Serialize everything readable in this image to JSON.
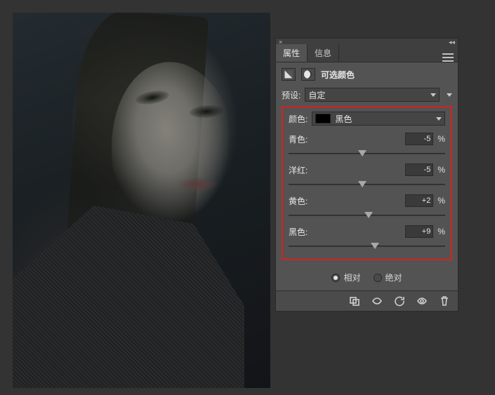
{
  "tabs": {
    "properties": "属性",
    "info": "信息"
  },
  "panel": {
    "title": "可选颜色"
  },
  "preset": {
    "label": "预设:",
    "value": "自定"
  },
  "color": {
    "label": "颜色:",
    "value": "黑色"
  },
  "sliders": {
    "cyan": {
      "label": "青色:",
      "value": "-5",
      "percent": "%",
      "pos": 47
    },
    "magenta": {
      "label": "洋红:",
      "value": "-5",
      "percent": "%",
      "pos": 47
    },
    "yellow": {
      "label": "黄色:",
      "value": "+2",
      "percent": "%",
      "pos": 51
    },
    "black": {
      "label": "黑色:",
      "value": "+9",
      "percent": "%",
      "pos": 55
    }
  },
  "mode": {
    "relative": "相对",
    "absolute": "绝对"
  }
}
